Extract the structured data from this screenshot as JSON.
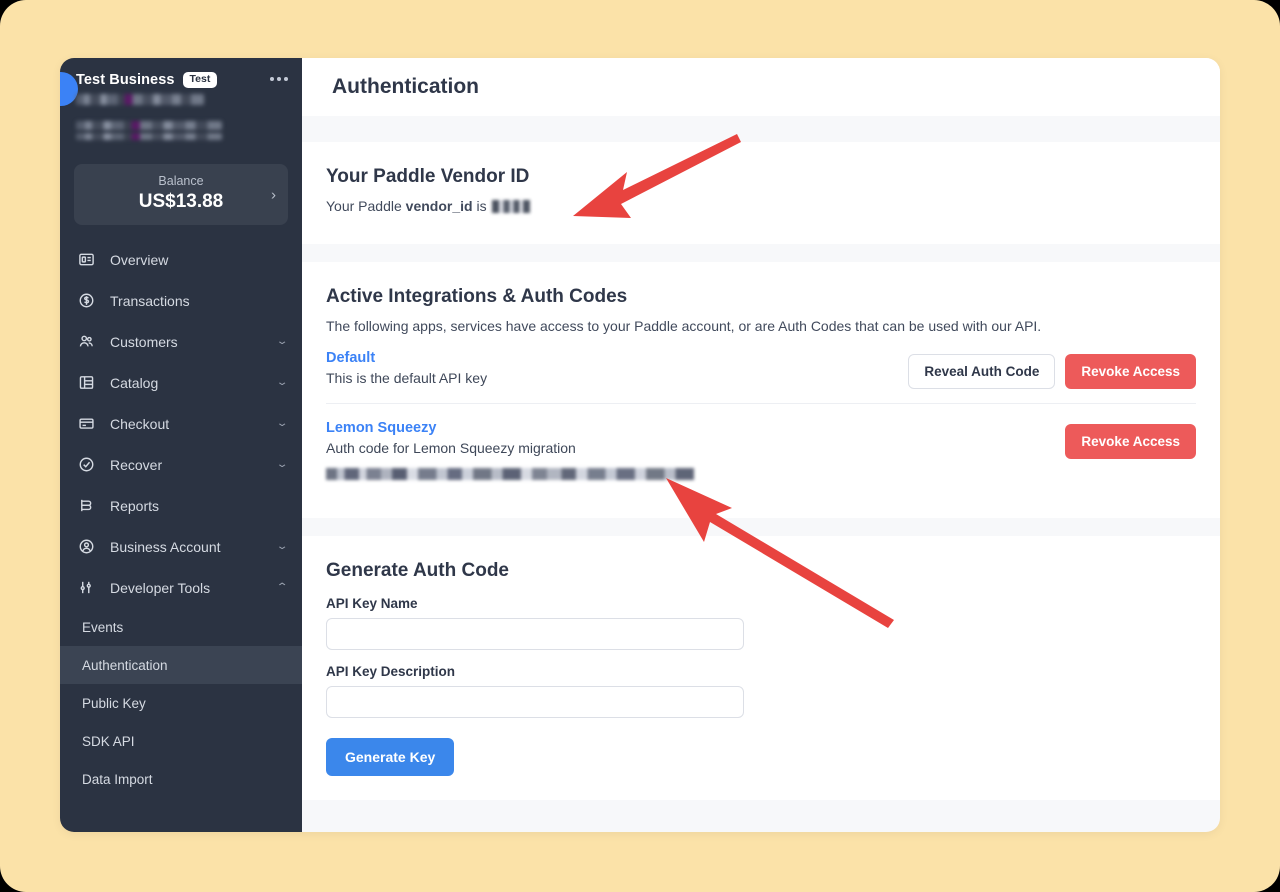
{
  "sidebar": {
    "business_name": "Test Business",
    "badge": "Test",
    "menu_icon": "three-dots-icon",
    "balance_label": "Balance",
    "balance_value": "US$13.88",
    "nav": [
      {
        "label": "Overview",
        "icon": "overview-icon",
        "expandable": false,
        "expanded": false
      },
      {
        "label": "Transactions",
        "icon": "dollar-circle-icon",
        "expandable": false,
        "expanded": false
      },
      {
        "label": "Customers",
        "icon": "people-icon",
        "expandable": true,
        "expanded": false
      },
      {
        "label": "Catalog",
        "icon": "catalog-icon",
        "expandable": true,
        "expanded": false
      },
      {
        "label": "Checkout",
        "icon": "card-icon",
        "expandable": true,
        "expanded": false
      },
      {
        "label": "Recover",
        "icon": "check-circle-icon",
        "expandable": true,
        "expanded": false
      },
      {
        "label": "Reports",
        "icon": "reports-icon",
        "expandable": false,
        "expanded": false
      },
      {
        "label": "Business Account",
        "icon": "user-circle-icon",
        "expandable": true,
        "expanded": false
      },
      {
        "label": "Developer Tools",
        "icon": "sliders-icon",
        "expandable": true,
        "expanded": true
      }
    ],
    "sub_items": [
      {
        "label": "Events",
        "active": false
      },
      {
        "label": "Authentication",
        "active": true
      },
      {
        "label": "Public Key",
        "active": false
      },
      {
        "label": "SDK API",
        "active": false
      },
      {
        "label": "Data Import",
        "active": false
      }
    ]
  },
  "header": {
    "title": "Authentication"
  },
  "vendor_section": {
    "title": "Your Paddle Vendor ID",
    "desc_prefix": "Your Paddle ",
    "desc_bold": "vendor_id",
    "desc_suffix": " is ",
    "value": "[redacted]"
  },
  "integrations": {
    "title": "Active Integrations & Auth Codes",
    "subtitle": "The following apps, services have access to your Paddle account, or are Auth Codes that can be used with our API.",
    "rows": [
      {
        "name": "Default",
        "description": "This is the default API key",
        "code": "",
        "buttons": [
          "Reveal Auth Code",
          "Revoke Access"
        ]
      },
      {
        "name": "Lemon Squeezy",
        "description": "Auth code for Lemon Squeezy migration",
        "code": "[redacted auth code]",
        "buttons": [
          "Revoke Access"
        ]
      }
    ],
    "reveal_label": "Reveal Auth Code",
    "revoke_label": "Revoke Access"
  },
  "generate": {
    "title": "Generate Auth Code",
    "name_label": "API Key Name",
    "name_value": "",
    "name_placeholder": "",
    "desc_label": "API Key Description",
    "desc_value": "",
    "desc_placeholder": "",
    "button_label": "Generate Key"
  },
  "annotations": {
    "arrow_color": "#e8433f",
    "arrows": [
      {
        "name": "arrow-to-vendor-id",
        "points_to": "vendor_id value"
      },
      {
        "name": "arrow-to-auth-code",
        "points_to": "Lemon Squeezy auth code"
      }
    ]
  },
  "colors": {
    "page_background": "#fbe2a8",
    "sidebar": "#2b3342",
    "accent_blue": "#3b82f6",
    "danger_red": "#ed5a5a",
    "content_background": "#f7f8fa"
  }
}
